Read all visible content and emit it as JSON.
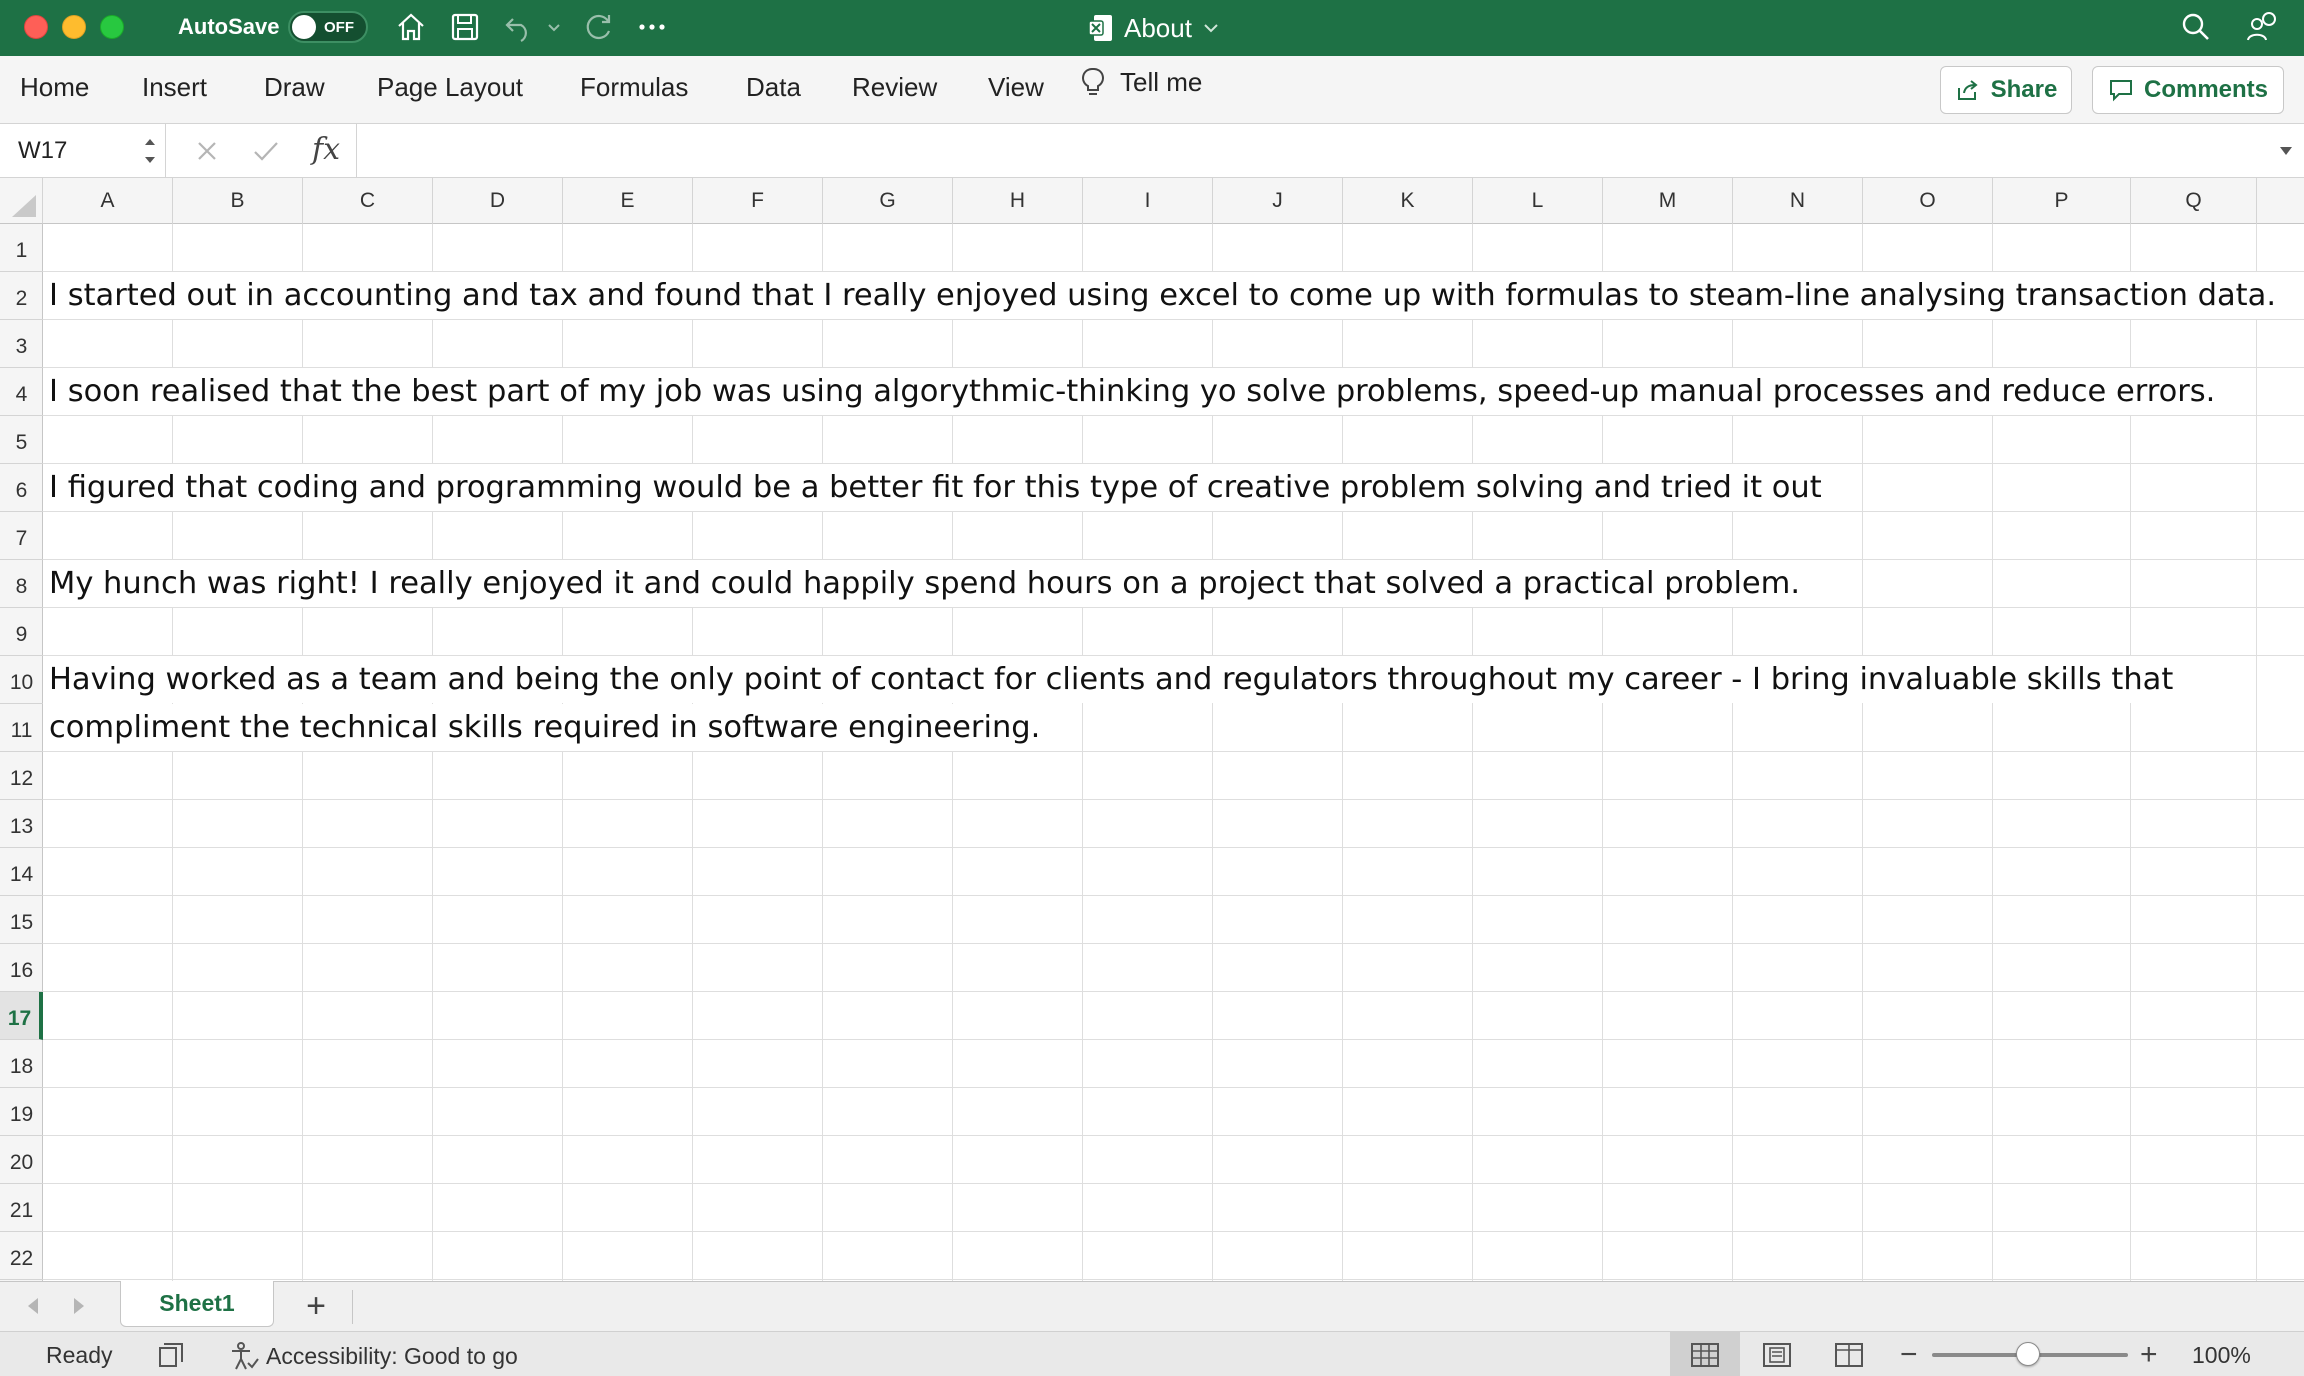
{
  "titlebar": {
    "autosave_label": "AutoSave",
    "autosave_state": "OFF",
    "doc_title": "About"
  },
  "ribbon": {
    "tabs": [
      "Home",
      "Insert",
      "Draw",
      "Page Layout",
      "Formulas",
      "Data",
      "Review",
      "View"
    ],
    "tell_me": "Tell me",
    "share_label": "Share",
    "comments_label": "Comments"
  },
  "formula_bar": {
    "cell_reference": "W17",
    "fx_label": "fx",
    "content": ""
  },
  "sheet": {
    "columns": [
      "A",
      "B",
      "C",
      "D",
      "E",
      "F",
      "G",
      "H",
      "I",
      "J",
      "K",
      "L",
      "M",
      "N",
      "O",
      "P",
      "Q"
    ],
    "rows": [
      "1",
      "2",
      "3",
      "4",
      "5",
      "6",
      "7",
      "8",
      "9",
      "10",
      "11",
      "12",
      "13",
      "14",
      "15",
      "16",
      "17",
      "18",
      "19",
      "20",
      "21",
      "22"
    ],
    "active_row": "17",
    "cells": [
      {
        "ref": "A2",
        "text": "I started out in accounting and tax and found that I really enjoyed using excel to come up with formulas to steam-line analysing transaction data."
      },
      {
        "ref": "A4",
        "text": "I soon realised that the best part of my job was using algorythmic-thinking yo solve problems, speed-up manual processes and reduce errors."
      },
      {
        "ref": "A6",
        "text": "I figured that coding and programming would be a better fit for this type of creative problem solving and tried it out"
      },
      {
        "ref": "A8",
        "text": "My hunch was right! I really enjoyed it and could happily spend hours on a project that solved a practical problem."
      },
      {
        "ref": "A10",
        "text": "Having worked as a team and being the only point of contact for clients and regulators throughout my career - I bring invaluable skills that"
      },
      {
        "ref": "A11",
        "text": "compliment the technical skills required in software engineering."
      }
    ]
  },
  "sheet_tabs": {
    "active": "Sheet1",
    "add_label": "+"
  },
  "statusbar": {
    "ready": "Ready",
    "accessibility": "Accessibility: Good to go",
    "zoom_minus": "−",
    "zoom_plus": "+",
    "zoom": "100%"
  },
  "colors": {
    "accent": "#1e7145",
    "close": "#fe5f57",
    "minimize": "#febc2e",
    "maximize": "#28c840"
  }
}
